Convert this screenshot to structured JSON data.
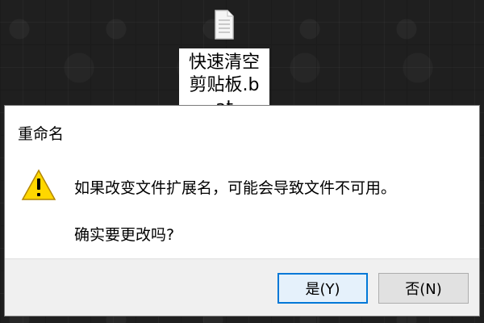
{
  "desktop": {
    "file_name": "快速清空剪贴板.bat"
  },
  "dialog": {
    "title": "重命名",
    "message_1": "如果改变文件扩展名，可能会导致文件不可用。",
    "message_2": "确实要更改吗?",
    "buttons": {
      "yes": "是(Y)",
      "no": "否(N)"
    }
  },
  "colors": {
    "desktop_background": "#1f1f1f",
    "dialog_background": "#ffffff",
    "footer_background": "#f0f0f0",
    "button_background": "#e1e1e1",
    "button_border": "#adadad",
    "focus_border": "#0078d7",
    "warning_fill": "#ffd700",
    "warning_stroke": "#b38600"
  },
  "icons": {
    "desktop_file": "text-file-icon",
    "dialog_warning": "warning-icon"
  }
}
